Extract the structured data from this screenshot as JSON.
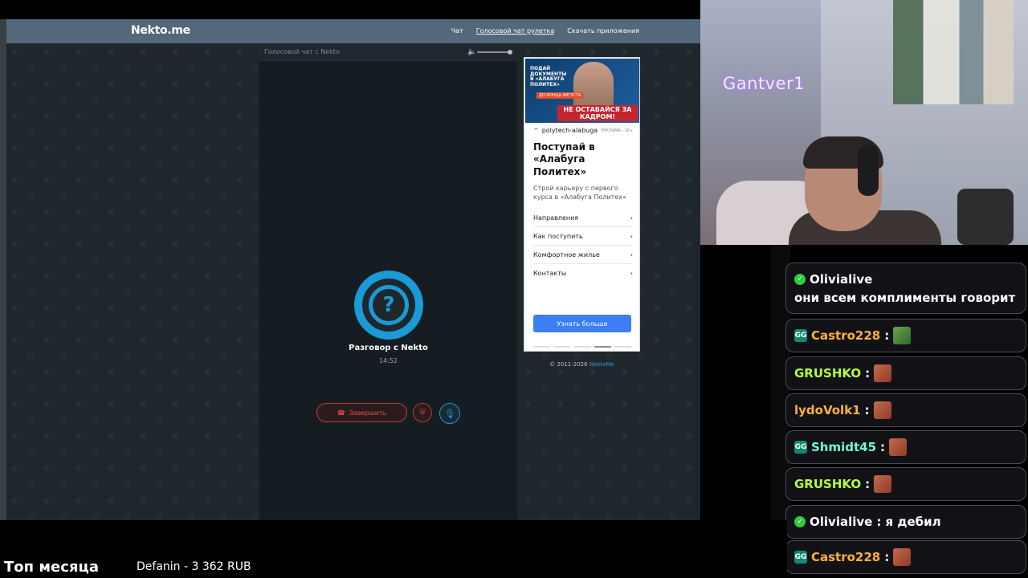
{
  "site": {
    "logo": "Nekto.me",
    "nav": [
      "Чат",
      "Голосовой чат рулетка",
      "Скачать приложения"
    ]
  },
  "call": {
    "header_title": "Голосовой чат с Nekto",
    "avatar_glyph": "?",
    "name": "Разговор с Nekto",
    "timer": "14:52",
    "end_label": "Завершить"
  },
  "ad": {
    "banner_top": "ПОДАЙ ДОКУМЕНТЫ В «АЛАБУГА ПОЛИТЕХ»",
    "banner_badge": "ДО КОНЦА АВГУСТА",
    "banner_main": "НЕ ОСТАВАЙСЯ ЗА КАДРОМ!",
    "source": "polytech-alabuga",
    "source_label": "РЕКЛАМА · 16+",
    "title": "Поступай в «Алабуга Политех»",
    "description": "Строй карьеру с первого курса в «Алабуга Политех»",
    "links": [
      "Направления",
      "Как поступить",
      "Комфортное жилье",
      "Контакты"
    ],
    "cta": "Узнать больше"
  },
  "footer": {
    "copyright": "© 2011-2026",
    "link": "NektoMe"
  },
  "stream": {
    "cam_name": "Gantver1",
    "top_month_label": "Топ месяца",
    "top_donor": "Defanin - 3 362 RUB"
  },
  "chat": {
    "messages": [
      {
        "nick": "Olivialive",
        "text": "они всем комплименты говорит",
        "badge": "check",
        "nick_color": "#ffffff"
      },
      {
        "nick": "Castro228",
        "text": ":",
        "badge": "gg",
        "nick_color": "#ffb13b",
        "emote": "frog"
      },
      {
        "nick": "GRUSHKO",
        "text": ":",
        "badge": "none",
        "nick_color": "#b6ff3b",
        "emote": "face"
      },
      {
        "nick": "lydoVolk1",
        "text": ":",
        "badge": "none",
        "nick_color": "#ffb13b",
        "emote": "face"
      },
      {
        "nick": "Shmidt45",
        "text": ":",
        "badge": "gg",
        "nick_color": "#6fffd0",
        "emote": "face"
      },
      {
        "nick": "GRUSHKO",
        "text": ":",
        "badge": "none",
        "nick_color": "#b6ff3b",
        "emote": "face"
      },
      {
        "nick": "Olivialive",
        "text": ": я дебил",
        "badge": "check",
        "nick_color": "#ffffff"
      },
      {
        "nick": "Castro228",
        "text": ":",
        "badge": "gg",
        "nick_color": "#ffb13b",
        "emote": "face"
      }
    ]
  }
}
